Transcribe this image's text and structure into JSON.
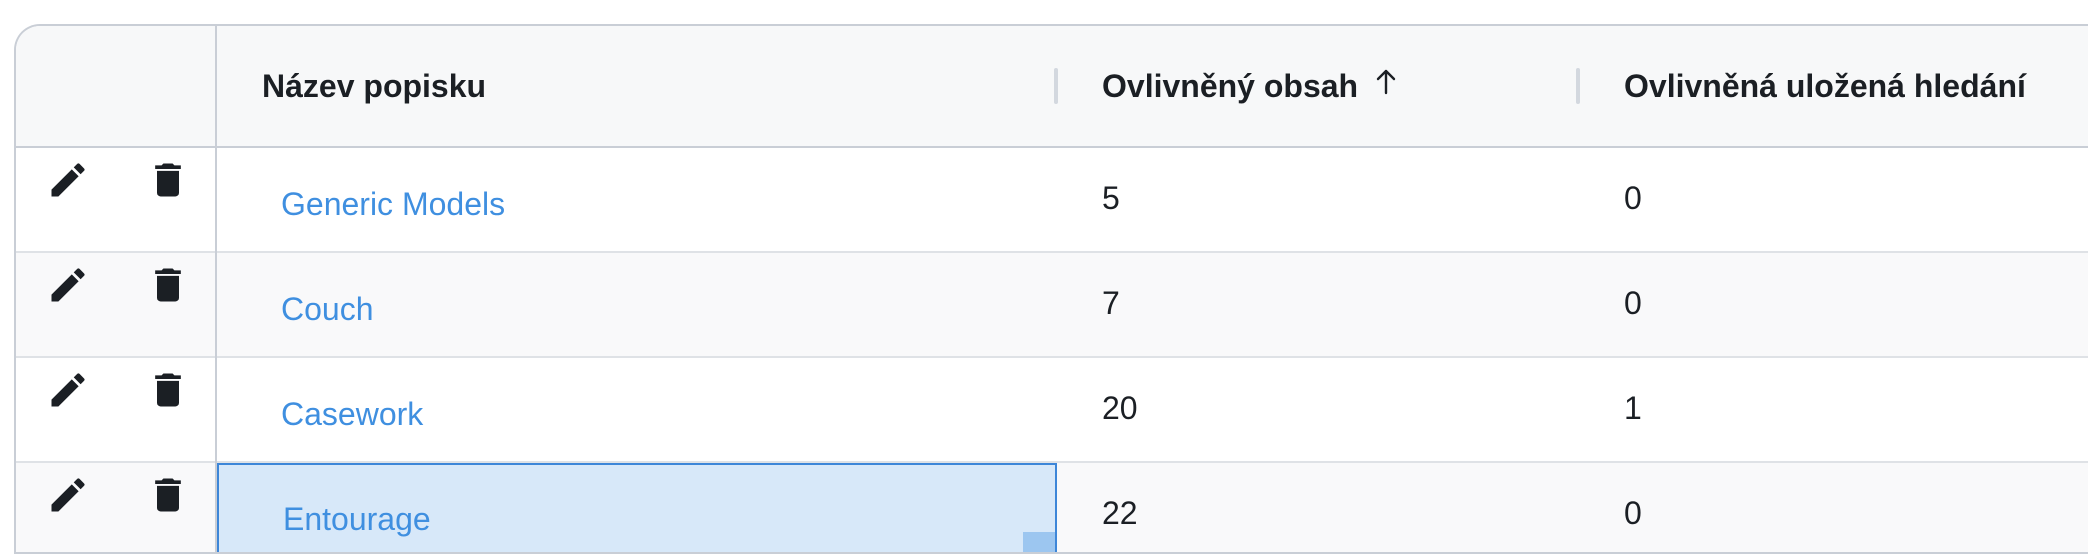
{
  "table": {
    "columns": {
      "name": "Název popisku",
      "affected_content": "Ovlivněný obsah",
      "affected_saved_searches": "Ovlivněná uložená hledání"
    },
    "sort": {
      "column": "affected_content",
      "direction": "ascending",
      "icon": "arrow-up-icon"
    },
    "actions": {
      "edit_icon": "pencil-icon",
      "delete_icon": "trash-icon"
    },
    "rows": [
      {
        "name": "Generic Models",
        "affected_content": "5",
        "affected_saved_searches": "0"
      },
      {
        "name": "Couch",
        "affected_content": "7",
        "affected_saved_searches": "0"
      },
      {
        "name": "Casework",
        "affected_content": "20",
        "affected_saved_searches": "1"
      },
      {
        "name": "Entourage",
        "affected_content": "22",
        "affected_saved_searches": "0",
        "selected": true
      }
    ]
  },
  "colors": {
    "link": "#3f8fe0",
    "selection_fill": "#d7e8f9",
    "selection_border": "#3d86d8",
    "header_bg": "#f7f8f9",
    "text": "#1b1f24"
  }
}
